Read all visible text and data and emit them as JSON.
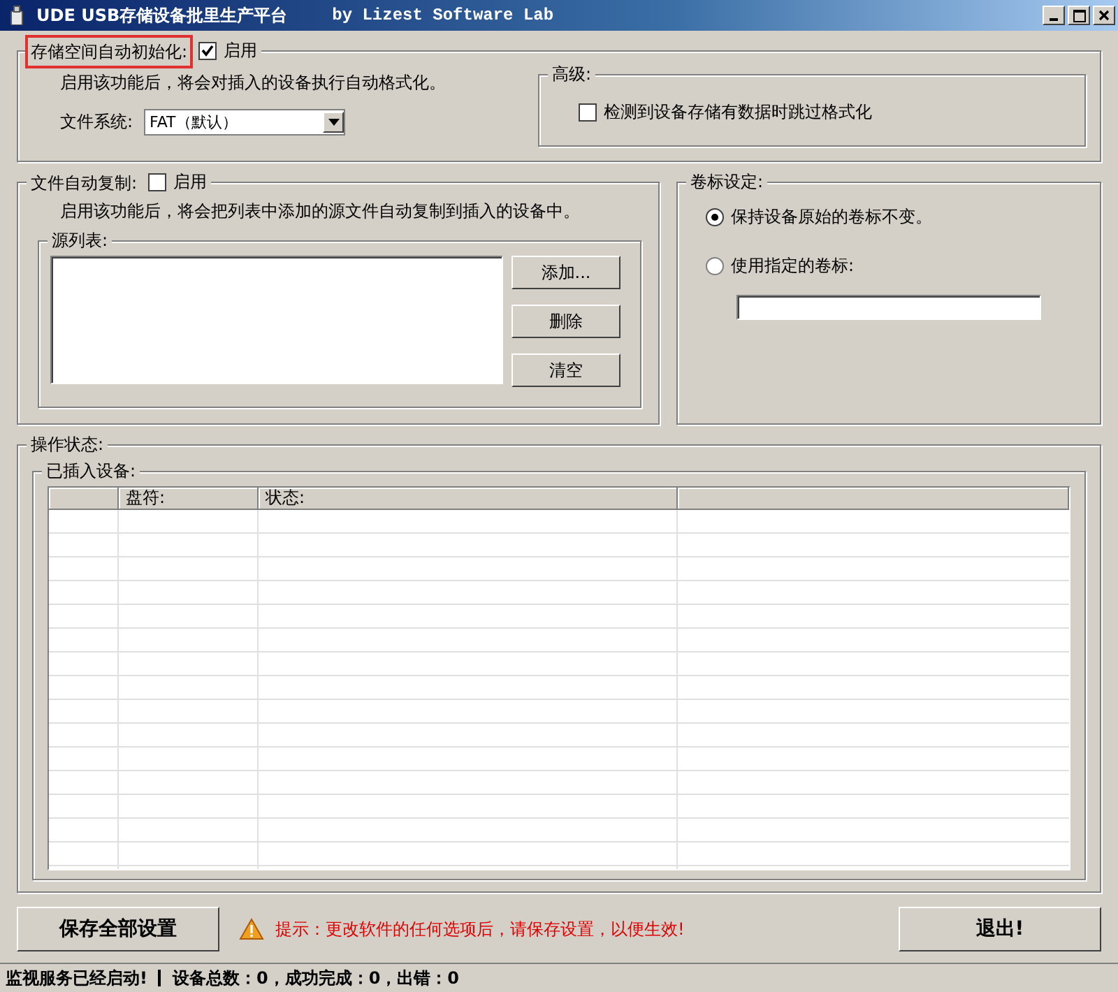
{
  "window": {
    "title": "UDE USB存储设备批里生产平台",
    "subtitle": "by Lizest Software Lab"
  },
  "format": {
    "title": "存储空间自动初始化:",
    "highlighted": true,
    "enabled": {
      "label": "启用",
      "checked": true
    },
    "description": "启用该功能后，将会对插入的设备执行自动格式化。",
    "fs_label": "文件系统:",
    "fs_value": "FAT（默认）",
    "advanced": {
      "title": "高级:",
      "option": {
        "label": "检测到设备存储有数据时跳过格式化",
        "checked": false
      }
    }
  },
  "copy": {
    "title": "文件自动复制:",
    "enabled": {
      "label": "启用",
      "checked": false
    },
    "description": "启用该功能后，将会把列表中添加的源文件自动复制到插入的设备中。",
    "source_title": "源列表:",
    "buttons": [
      "添加...",
      "删除",
      "清空"
    ]
  },
  "volume": {
    "title": "卷标设定:",
    "options": [
      {
        "label": "保持设备原始的卷标不变。",
        "selected": true
      },
      {
        "label": "使用指定的卷标:",
        "selected": false
      }
    ]
  },
  "status": {
    "title": "操作状态:",
    "devices_title": "已插入设备:",
    "columns": [
      {
        "label": "盘符:"
      },
      {
        "label": "状态:"
      }
    ]
  },
  "save_button": "保存全部设置",
  "notice": "提示：更改软件的任何选项后，请保存设置，以便生效!",
  "exit_button": "退出!",
  "status_bar": {
    "service": "监视服务已经启动!",
    "summary": "设备总数：0，成功完成：0，出错：0"
  }
}
